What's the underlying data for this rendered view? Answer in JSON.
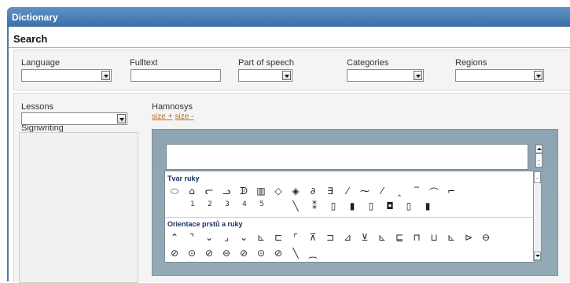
{
  "window": {
    "title": "Dictionary"
  },
  "section": {
    "heading": "Search"
  },
  "filters": {
    "language": {
      "label": "Language",
      "value": ""
    },
    "fulltext": {
      "label": "Fulltext",
      "value": ""
    },
    "part_of_speech": {
      "label": "Part of speech",
      "value": ""
    },
    "categories": {
      "label": "Categories",
      "value": ""
    },
    "regions": {
      "label": "Regions",
      "value": ""
    }
  },
  "lessons": {
    "label": "Lessons",
    "value": ""
  },
  "signwriting": {
    "label": "Signwriting"
  },
  "hamnosys": {
    "label": "Hamnosys",
    "size_plus": "size +",
    "size_minus": "size -",
    "input_value": "",
    "sections": [
      {
        "title": "Tvar ruky",
        "row1_glyphs": [
          "⬭",
          "⌂",
          "ᓕ",
          "ᓗ",
          "ᗫ",
          "▥",
          "◇",
          "◈",
          "∂",
          "∃",
          "⁄",
          "⁓",
          "⁄",
          "‸",
          "‾",
          "⌒",
          "⌐"
        ],
        "row2_numbers": [
          "1",
          "2",
          "3",
          "4",
          "5"
        ],
        "row2_glyphs": [
          "⁔",
          "╲",
          "⁑",
          "▯",
          "▮",
          "▯",
          "◘",
          "▯",
          "▮"
        ]
      },
      {
        "title": "Orientace prstů a ruky",
        "row1_glyphs": [
          "⌃",
          "⌝",
          "⌄",
          "⌟",
          "⌄",
          "⊾",
          "⊏",
          "⌜",
          "⊼",
          "⊐",
          "⊿",
          "⊻",
          "⊾",
          "⊑",
          "⊓",
          "⊔",
          "⊾",
          "⊳",
          "⊖"
        ],
        "row2_glyphs": [
          "⊘",
          "⊙",
          "⊘",
          "⊖",
          "⊘",
          "⊙",
          "⊘",
          "╲",
          "⁔"
        ]
      }
    ]
  },
  "icons": {
    "dropdown": "chevron-down-icon",
    "scroll_up": "chevron-up-icon",
    "scroll_down": "chevron-down-icon"
  }
}
